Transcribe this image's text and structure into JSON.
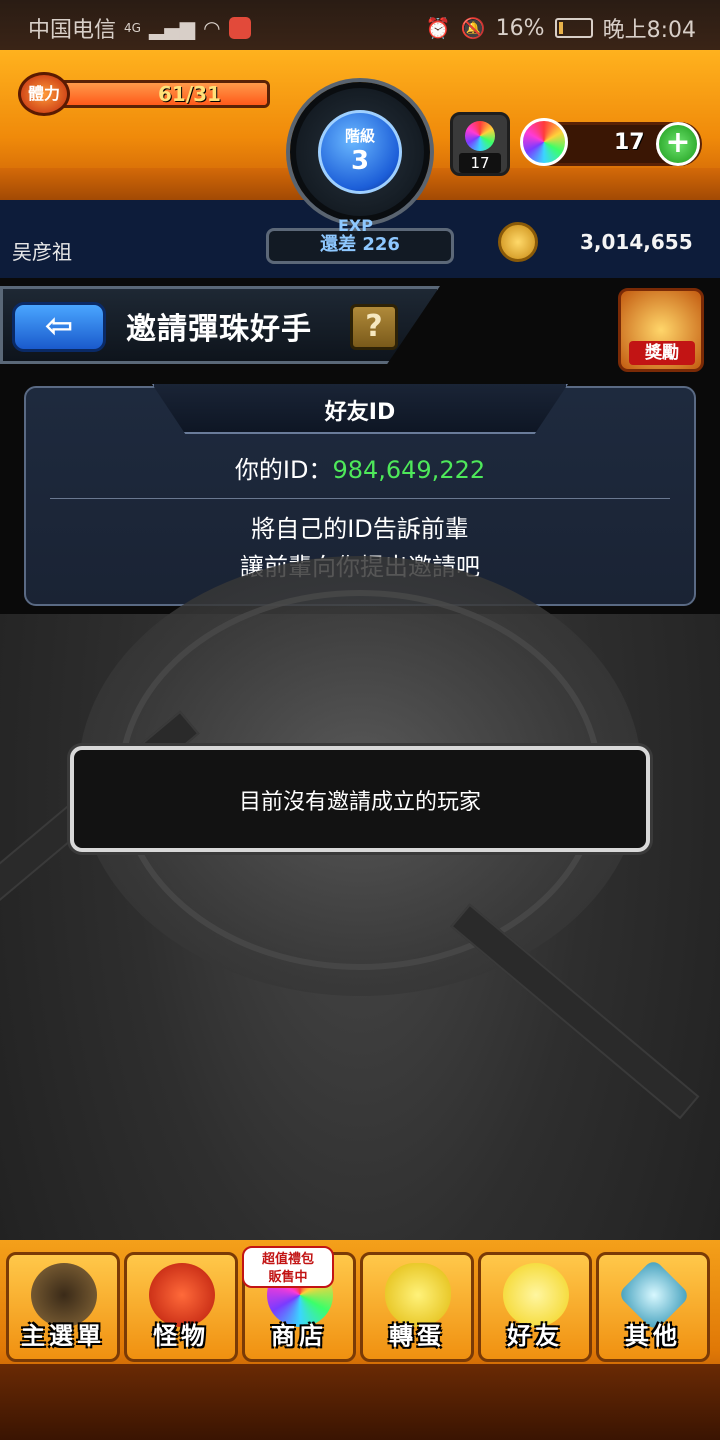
{
  "status_bar": {
    "carrier": "中国电信",
    "network": "4G",
    "battery": "16%",
    "battery_level": 0.16,
    "time": "晚上8:04"
  },
  "hud": {
    "stamina_label": "體力",
    "stamina_value": "61/31",
    "rank_label": "階級",
    "rank_value": "3",
    "exp_label": "EXP",
    "exp_remaining": "還差 226",
    "orb_box_count": "17",
    "orb_count": "17",
    "plus_label": "+",
    "username": "吴彦祖",
    "coins": "3,014,655"
  },
  "title_bar": {
    "back_label": "⇦",
    "title": "邀請彈珠好手",
    "help_label": "?",
    "reward_label": "獎勵"
  },
  "friend_id": {
    "header": "好友ID",
    "id_label": "你的ID：",
    "id_value": "984,649,222",
    "message_line1": "將自己的ID告訴前輩",
    "message_line2": "讓前輩向你提出邀請吧"
  },
  "main": {
    "empty_message": "目前沒有邀請成立的玩家"
  },
  "promo": {
    "line1": "超值禮包",
    "line2": "販售中"
  },
  "nav": [
    {
      "label": "主選單",
      "icon": "gate-icon"
    },
    {
      "label": "怪物",
      "icon": "monster-icon"
    },
    {
      "label": "商店",
      "icon": "rainbow-orb-icon"
    },
    {
      "label": "轉蛋",
      "icon": "egg-icon"
    },
    {
      "label": "好友",
      "icon": "friends-icon"
    },
    {
      "label": "其他",
      "icon": "other-icon"
    }
  ],
  "colors": {
    "accent_orange": "#f08a0a",
    "navy": "#0d1c3a",
    "id_green": "#4ee85a",
    "blue_button": "#1a5acc"
  }
}
